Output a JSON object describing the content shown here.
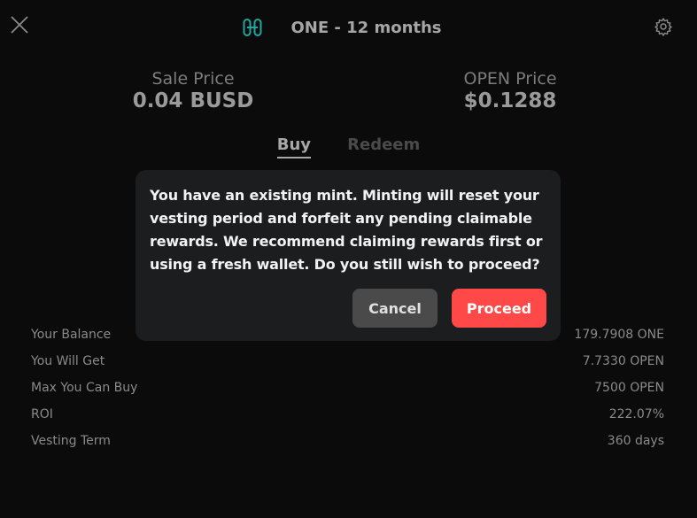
{
  "header": {
    "title": "ONE - 12 months",
    "token_icon": "harmony-one-icon",
    "accent": "#1fa7a0"
  },
  "prices": {
    "sale": {
      "label": "Sale Price",
      "value": "0.04 BUSD"
    },
    "open": {
      "label": "OPEN Price",
      "value": "$0.1288"
    }
  },
  "tabs": [
    {
      "label": "Buy",
      "active": true
    },
    {
      "label": "Redeem",
      "active": false
    }
  ],
  "info": [
    {
      "label": "Your Balance",
      "value": "179.7908 ONE"
    },
    {
      "label": "You Will Get",
      "value": "7.7330 OPEN"
    },
    {
      "label": "Max You Can Buy",
      "value": "7500 OPEN"
    },
    {
      "label": "ROI",
      "value": "222.07%"
    },
    {
      "label": "Vesting Term",
      "value": "360 days"
    }
  ],
  "dialog": {
    "message": "You have an existing mint. Minting will reset your vesting period and forfeit any pending claimable rewards. We recommend claiming rewards first or using a fresh wallet. Do you still wish to proceed?",
    "cancel_label": "Cancel",
    "proceed_label": "Proceed",
    "proceed_color": "#ff4848"
  }
}
